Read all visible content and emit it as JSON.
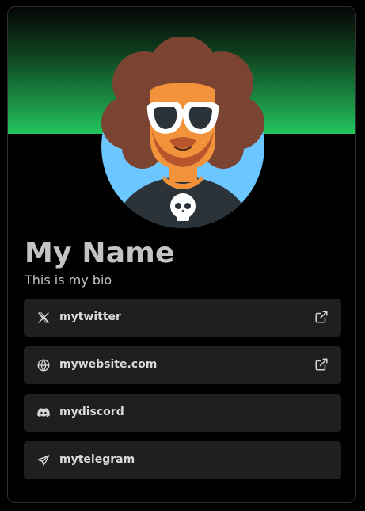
{
  "profile": {
    "name": "My Name",
    "bio": "This is my bio"
  },
  "colors": {
    "banner_top": "#050505",
    "banner_bottom": "#22c55e",
    "card_bg": "#000000",
    "link_bg": "#1f1f1f",
    "avatar_bg": "#6cc6ff"
  },
  "links": [
    {
      "label": "mytwitter",
      "icon": "x-icon",
      "external": true
    },
    {
      "label": "mywebsite.com",
      "icon": "globe-icon",
      "external": true
    },
    {
      "label": "mydiscord",
      "icon": "discord-icon",
      "external": false
    },
    {
      "label": "mytelegram",
      "icon": "telegram-icon",
      "external": false
    }
  ]
}
